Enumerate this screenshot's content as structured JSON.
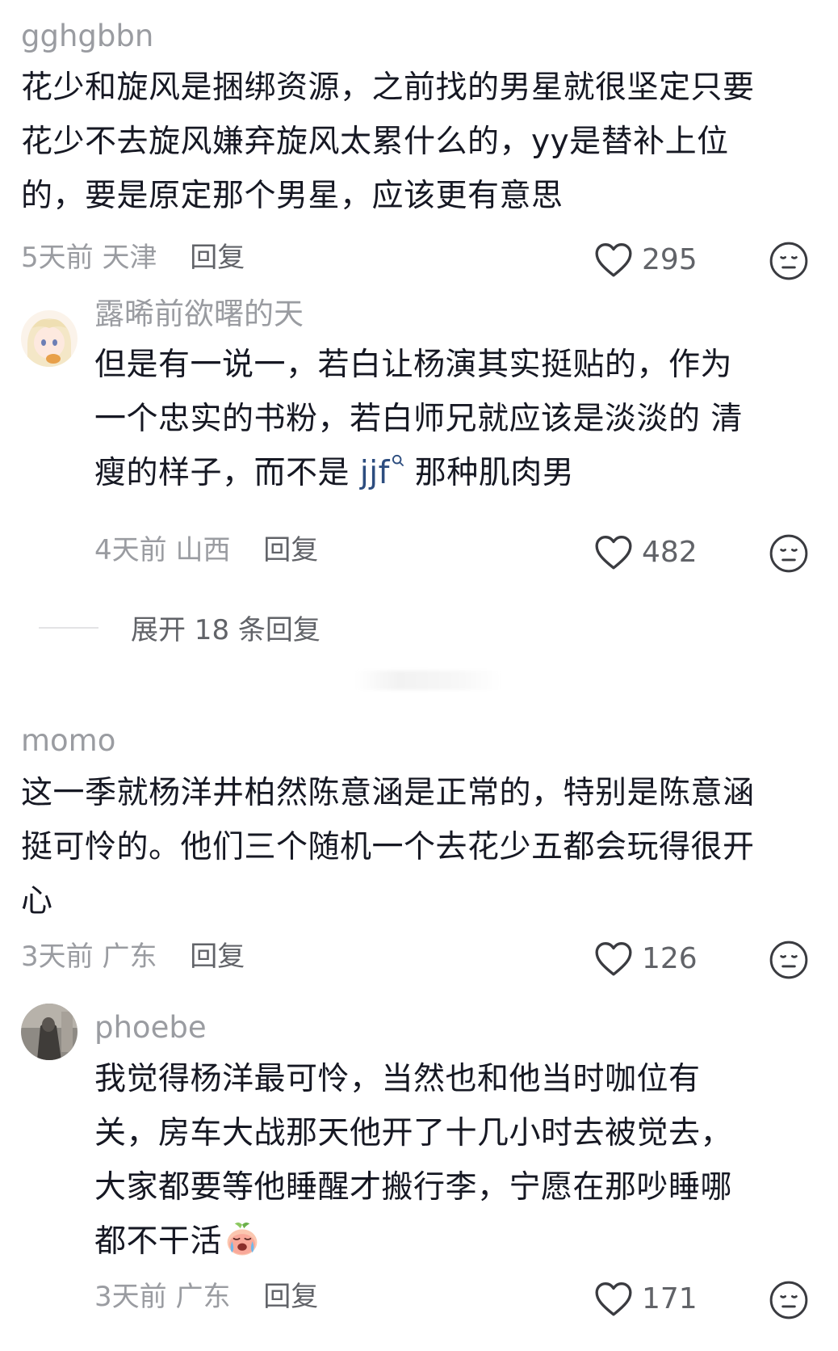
{
  "comments": [
    {
      "username": "gghgbbn",
      "lines": [
        "花少和旋风是捆绑资源，之前找的男星就很坚定只要",
        "花少不去旋风嫌弃旋风太累什么的，yy是替补上位",
        "的，要是原定那个男星，应该更有意思"
      ],
      "time": "5天前",
      "location": "天津",
      "reply_label": "回复",
      "likes": "295"
    },
    {
      "username": "露晞前欲曙的天",
      "lines_pre": [
        "但是有一说一，若白让杨演其实挺贴的，作为",
        "一个忠实的书粉，若白师兄就应该是淡淡的 清"
      ],
      "line3_before": "瘦的样子，而不是 ",
      "mention": "jjf",
      "line3_after": " 那种肌肉男",
      "time": "4天前",
      "location": "山西",
      "reply_label": "回复",
      "likes": "482"
    },
    {
      "username": "momo",
      "lines": [
        "这一季就杨洋井柏然陈意涵是正常的，特别是陈意涵",
        "挺可怜的。他们三个随机一个去花少五都会玩得很开",
        "心"
      ],
      "time": "3天前",
      "location": "广东",
      "reply_label": "回复",
      "likes": "126"
    },
    {
      "username": "phoebe",
      "lines": [
        "我觉得杨洋最可怜，当然也和他当时咖位有",
        "关，房车大战那天他开了十几小时去被觉去，",
        "大家都要等他睡醒才搬行李，宁愿在那吵睡哪",
        "都不干活"
      ],
      "time": "3天前",
      "location": "广东",
      "reply_label": "回复",
      "likes": "171"
    }
  ],
  "expand_replies": {
    "label": "展开 18 条回复"
  },
  "icons": {
    "like": "heart-outline-icon",
    "dislike": "meh-face-icon",
    "search": "search-icon",
    "emoji": "crying-peach-emoji-icon"
  },
  "colors": {
    "text": "#161823",
    "secondary": "#9a9ca1",
    "reply": "#616368",
    "mention": "#2d4d7f"
  }
}
